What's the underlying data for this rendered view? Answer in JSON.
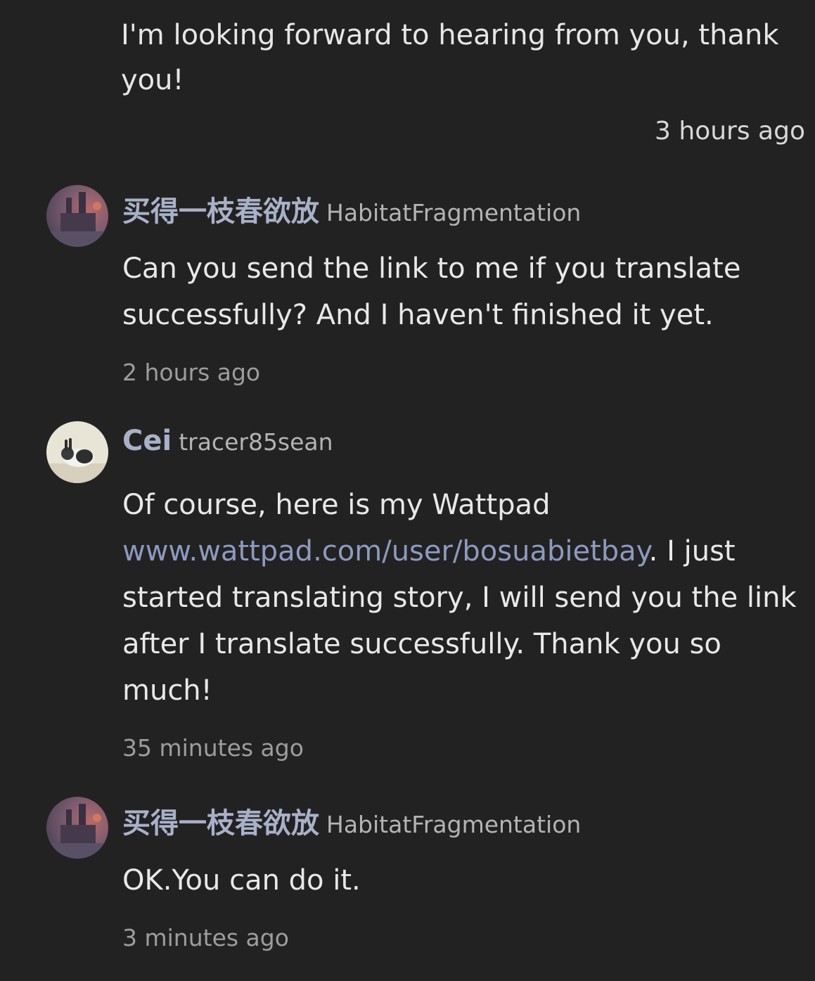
{
  "top_comment": {
    "text": "I'm looking forward to hearing from you, thank you!",
    "time": "3 hours ago"
  },
  "comments": [
    {
      "display_name": "买得一枝春欲放",
      "username": "HabitatFragmentation",
      "text": "Can you send the link to me if you translate successfully? And I haven't finished it yet.",
      "time": "2 hours ago",
      "avatar": "painting-avatar"
    },
    {
      "display_name": "Cei",
      "username": "tracer85sean",
      "text_before_link": "Of course, here is my Wattpad ",
      "link": "www.wattpad.com/user/bosuabietbay",
      "text_after_link": ". I just started translating story, I will send you the link after I translate successfully. Thank you so much!",
      "time": "35 minutes ago",
      "avatar": "rabbit-avatar"
    },
    {
      "display_name": "买得一枝春欲放",
      "username": "HabitatFragmentation",
      "text": "OK.You can do it.",
      "time": "3 minutes ago",
      "avatar": "painting-avatar"
    }
  ],
  "colors": {
    "background": "#222222",
    "display_name": "#a9b1c9",
    "link": "#8d9ac0",
    "timestamp": "#9d9d9d"
  }
}
